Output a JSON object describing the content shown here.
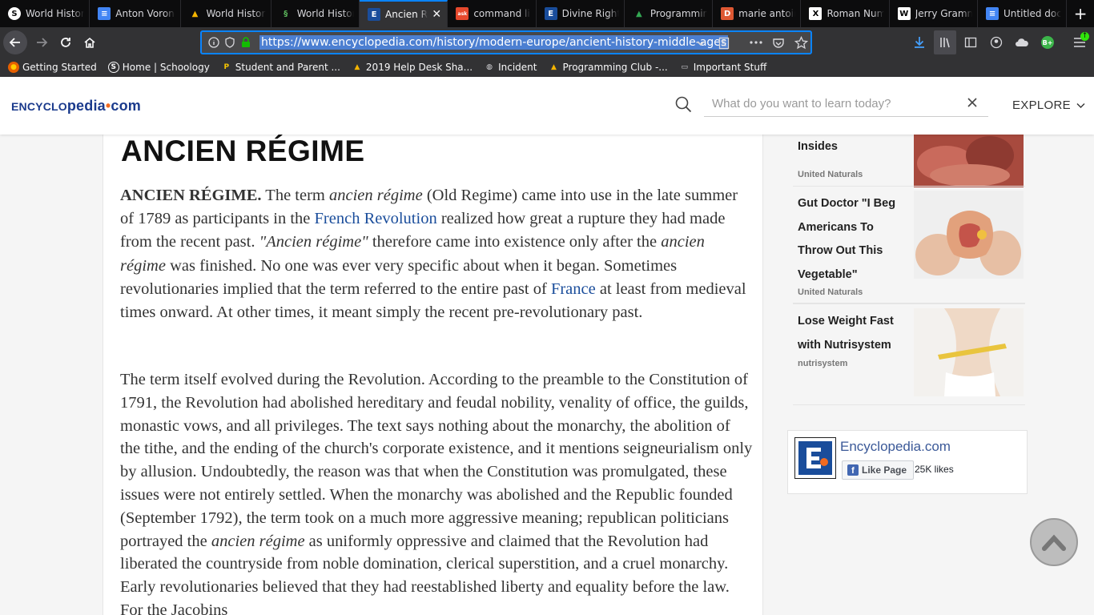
{
  "tabs": [
    {
      "label": "World History",
      "fav": "S",
      "fav_bg": "#ffffff",
      "fav_fg": "#0c0c0d"
    },
    {
      "label": "Anton Vorono",
      "fav": "≡",
      "fav_bg": "#4285f4",
      "fav_fg": "#ffffff"
    },
    {
      "label": "World History",
      "fav": "▲",
      "fav_bg": "transparent",
      "fav_fg": "#f4b400"
    },
    {
      "label": "World History",
      "fav": "§",
      "fav_bg": "transparent",
      "fav_fg": "#5cb85c"
    },
    {
      "label": "Ancien Ré",
      "fav": "E",
      "fav_bg": "#1a4d9b",
      "fav_fg": "#ffffff",
      "active": true
    },
    {
      "label": "command line",
      "fav": "ask",
      "fav_bg": "#e6492d",
      "fav_fg": "#ffffff"
    },
    {
      "label": "Divine Right",
      "fav": "E",
      "fav_bg": "#1a4d9b",
      "fav_fg": "#ffffff"
    },
    {
      "label": "Programming",
      "fav": "▲",
      "fav_bg": "transparent",
      "fav_fg": "#34a853"
    },
    {
      "label": "marie antoine",
      "fav": "D",
      "fav_bg": "#de5833",
      "fav_fg": "#ffffff"
    },
    {
      "label": "Roman Nume",
      "fav": "X",
      "fav_bg": "#ffffff",
      "fav_fg": "#000000"
    },
    {
      "label": "Jerry Gramm",
      "fav": "W",
      "fav_bg": "#ffffff",
      "fav_fg": "#000000"
    },
    {
      "label": "Untitled docu",
      "fav": "≡",
      "fav_bg": "#4285f4",
      "fav_fg": "#ffffff"
    }
  ],
  "url": "https://www.encyclopedia.com/history/modern-europe/ancient-history-middle-ages",
  "bookmarks": [
    {
      "label": "Getting Started",
      "icon": "firefox-icon"
    },
    {
      "label": "Home | Schoology",
      "icon": "schoology-icon"
    },
    {
      "label": "Student and Parent ...",
      "icon": "pearson-icon"
    },
    {
      "label": "2019 Help Desk Sha...",
      "icon": "drive-icon"
    },
    {
      "label": "Incident",
      "icon": "globe-icon"
    },
    {
      "label": "Programming Club -...",
      "icon": "drive-icon"
    },
    {
      "label": "Important Stuff",
      "icon": "folder-icon"
    }
  ],
  "site": {
    "logo_a": "ENCYCLO",
    "logo_b": "pedia",
    "logo_dot": "•",
    "logo_c": "com",
    "search_placeholder": "What do you want to learn today?",
    "explore": "EXPLORE"
  },
  "article": {
    "title": "ANCIEN RÉGIME",
    "p1": {
      "lead": "ANCIEN RÉGIME.",
      "t1": " The term ",
      "i1": "ancien régime",
      "t2": " (Old Regime) came into use in the late summer of 1789 as participants in the ",
      "link1": "French Revolution",
      "t3": " realized how great a rupture they had made from the recent past. ",
      "i2": "\"Ancien régime\"",
      "t4": " therefore came into existence only after the ",
      "i3": "ancien régime",
      "t5": " was finished. No one was ever very specific about when it began. Sometimes revolutionaries implied that the term referred to the entire past of ",
      "link2": "France",
      "t6": " at least from medieval times onward. At other times, it meant simply the recent pre-revolutionary past."
    },
    "p2": {
      "t1": "The term itself evolved during the Revolution. According to the preamble to the Constitution of 1791, the Revolution had abolished hereditary and feudal nobility, venality of office, the guilds, monastic vows, and all privileges. The text says nothing about the monarchy, the abolition of the tithe, and the ending of the church's corporate existence, and it mentions seigneurialism only by allusion. Undoubtedly, the reason was that when the Constitution was promulgated, these issues were not entirely settled. When the monarchy was abolished and the Republic founded (September 1792), the term took on a much more aggressive meaning; republican politicians portrayed the ",
      "i1": "ancien régime",
      "t2": " as uniformly oppressive and claimed that the Revolution had liberated the countryside from noble domination, clerical superstition, and a cruel monarchy. Early revolutionaries believed that they had reestablished liberty and equality before the law. For the Jacobins"
    }
  },
  "ads": [
    {
      "title": "Destroys Your Insides",
      "source": "United Naturals"
    },
    {
      "title": "Gut Doctor \"I Beg Americans To Throw Out This Vegetable\"",
      "source": "United Naturals"
    },
    {
      "title": "Lose Weight Fast with Nutrisystem",
      "source": "nutrisystem"
    }
  ],
  "facebook": {
    "page_name": "Encyclopedia.com",
    "like_label": "Like Page",
    "likes": "25K likes"
  },
  "colors": {
    "accent": "#0a84ff",
    "link": "#1a4d9b",
    "brand": "#1a3a8c",
    "brand_dot": "#f26b21"
  }
}
